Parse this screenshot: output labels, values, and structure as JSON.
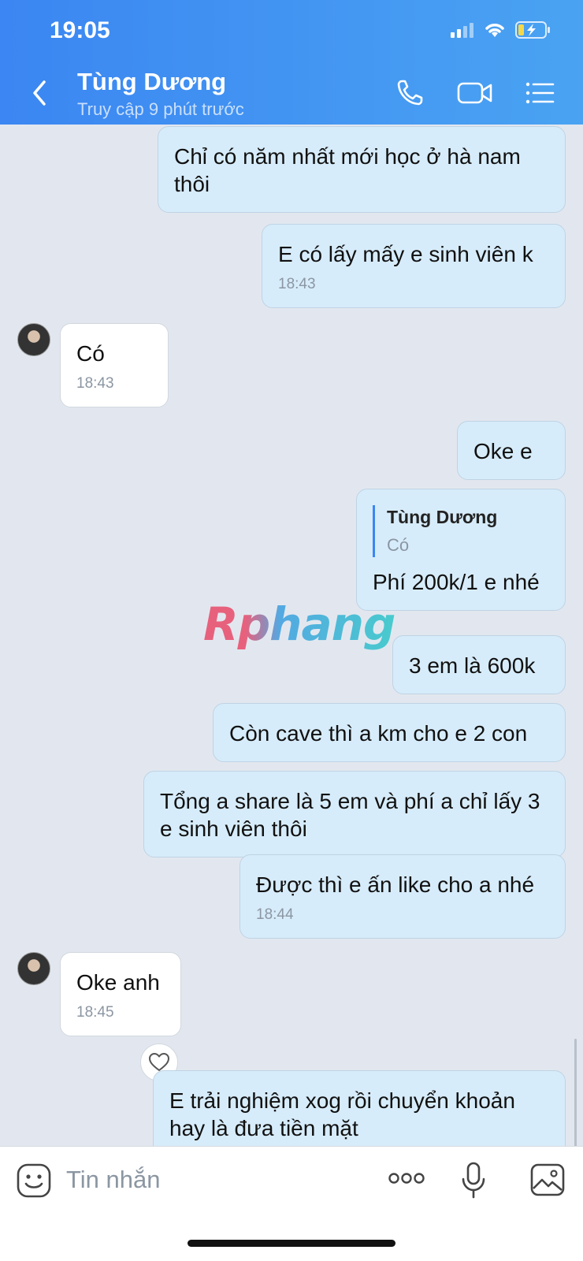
{
  "status_bar": {
    "time": "19:05"
  },
  "header": {
    "contact_name": "Tùng Dương",
    "contact_status": "Truy cập 9 phút trước"
  },
  "messages": [
    {
      "direction": "out",
      "text": "Chỉ có năm nhất mới học ở hà nam thôi"
    },
    {
      "direction": "out",
      "text": "E có lấy mấy e sinh viên k",
      "time": "18:43"
    },
    {
      "direction": "in",
      "text": "Có",
      "time": "18:43"
    },
    {
      "direction": "out",
      "text": "Oke e"
    },
    {
      "direction": "out",
      "text": "Phí 200k/1 e nhé",
      "quote": {
        "name": "Tùng Dương",
        "text": "Có"
      }
    },
    {
      "direction": "out",
      "text": "3 em là 600k"
    },
    {
      "direction": "out",
      "text": "Còn cave thì a km cho e 2 con"
    },
    {
      "direction": "out",
      "text": "Tổng a share là 5 em và phí a chỉ lấy 3 e sinh viên thôi"
    },
    {
      "direction": "out",
      "text": "Được thì e ấn like cho a nhé",
      "time": "18:44"
    },
    {
      "direction": "in",
      "text": "Oke anh",
      "time": "18:45"
    },
    {
      "direction": "out",
      "text": "E trải nghiệm xog rồi chuyển khoản hay là đưa tiền mặt"
    }
  ],
  "watermark": "Rphang",
  "input": {
    "placeholder": "Tin nhắn"
  },
  "colors": {
    "header_start": "#3b86f2",
    "header_end": "#4aa3f2",
    "outgoing_bubble": "#d7ecfa",
    "incoming_bubble": "#ffffff",
    "chat_bg": "#e2e7ef"
  },
  "icons": [
    "back-chevron-icon",
    "phone-icon",
    "video-call-icon",
    "menu-list-icon",
    "sticker-emoji-icon",
    "more-dots-icon",
    "microphone-icon",
    "image-gallery-icon",
    "heart-icon"
  ]
}
